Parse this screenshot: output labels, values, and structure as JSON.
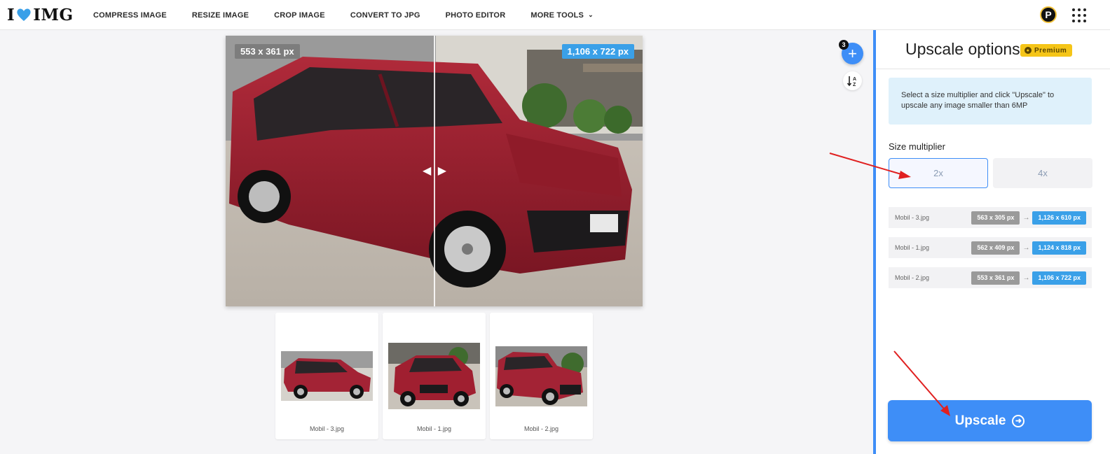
{
  "header": {
    "logo_left": "I",
    "logo_right": "IMG",
    "nav": [
      "COMPRESS IMAGE",
      "RESIZE IMAGE",
      "CROP IMAGE",
      "CONVERT TO JPG",
      "PHOTO EDITOR",
      "MORE TOOLS"
    ],
    "user_initial": "P"
  },
  "preview": {
    "original_size": "553 x 361 px",
    "upscaled_size": "1,106 x 722 px",
    "file_count": "3"
  },
  "thumbnails": [
    {
      "label": "Mobil - 3.jpg"
    },
    {
      "label": "Mobil - 1.jpg"
    },
    {
      "label": "Mobil - 2.jpg"
    }
  ],
  "sidebar": {
    "title": "Upscale options",
    "premium_label": "Premium",
    "info": "Select a size multiplier and click \"Upscale\" to upscale any image smaller than 6MP",
    "size_label": "Size multiplier",
    "options": [
      "2x",
      "4x"
    ],
    "selected_option": "2x",
    "files": [
      {
        "name": "Mobil - 3.jpg",
        "from": "563 x 305 px",
        "to": "1,126 x 610 px"
      },
      {
        "name": "Mobil - 1.jpg",
        "from": "562 x 409 px",
        "to": "1,124 x 818 px"
      },
      {
        "name": "Mobil - 2.jpg",
        "from": "553 x 361 px",
        "to": "1,106 x 722 px"
      }
    ],
    "upscale_label": "Upscale"
  },
  "colors": {
    "accent": "#3e8ef7",
    "info_bg": "#dff1fb",
    "premium": "#f5c518",
    "car_red": "#9e1f2e",
    "annotation_arrow": "#e02020"
  }
}
